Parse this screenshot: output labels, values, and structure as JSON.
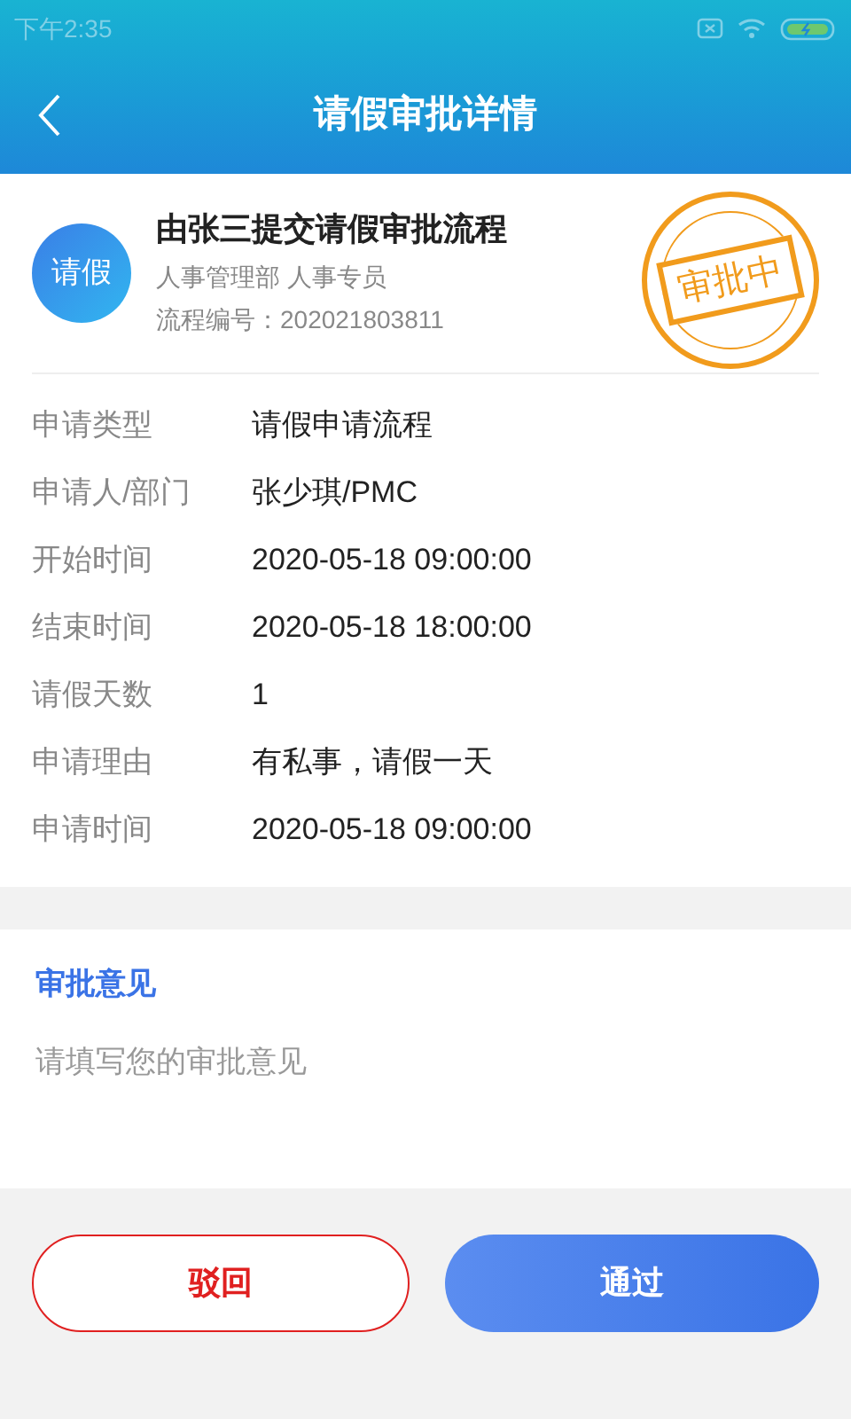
{
  "status_bar": {
    "time": "下午2:35"
  },
  "header": {
    "title": "请假审批详情"
  },
  "summary": {
    "avatar": "请假",
    "title": "由张三提交请假审批流程",
    "department": "人事管理部 人事专员",
    "number": "流程编号：202021803811",
    "stamp": "审批中"
  },
  "fields": [
    {
      "label": "申请类型",
      "value": "请假申请流程"
    },
    {
      "label": "申请人/部门",
      "value": "张少琪/PMC"
    },
    {
      "label": "开始时间",
      "value": "2020-05-18 09:00:00"
    },
    {
      "label": "结束时间",
      "value": "2020-05-18 18:00:00"
    },
    {
      "label": "请假天数",
      "value": "1"
    },
    {
      "label": "申请理由",
      "value": "有私事，请假一天"
    },
    {
      "label": "申请时间",
      "value": "2020-05-18 09:00:00"
    }
  ],
  "opinion": {
    "title": "审批意见",
    "placeholder": "请填写您的审批意见"
  },
  "buttons": [
    {
      "label": "驳回",
      "kind": "reject"
    },
    {
      "label": "通过",
      "kind": "approve"
    }
  ]
}
